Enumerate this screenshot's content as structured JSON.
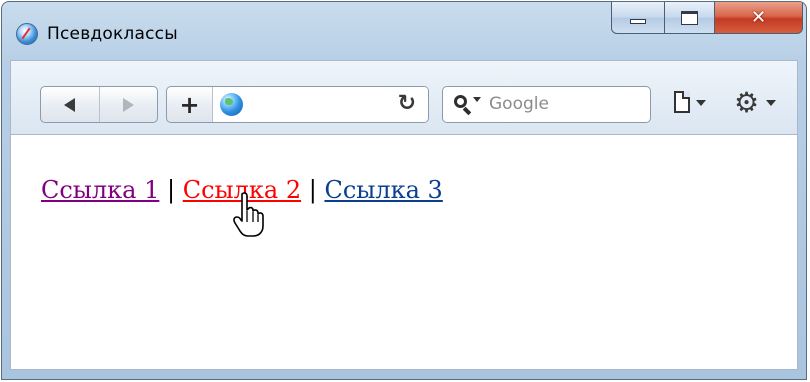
{
  "window": {
    "title": "Псевдоклассы"
  },
  "toolbar": {
    "search_placeholder": "Google"
  },
  "content": {
    "links": [
      {
        "label": "Ссылка 1",
        "state": "visited",
        "color": "#800080"
      },
      {
        "label": "Ссылка 2",
        "state": "hover",
        "color": "#ff0000"
      },
      {
        "label": "Ссылка 3",
        "state": "normal",
        "color": "#0b3e8f"
      }
    ],
    "separator": "|"
  },
  "colors": {
    "close_button": "#c33a22",
    "title_bar": "#b7cfe6"
  }
}
